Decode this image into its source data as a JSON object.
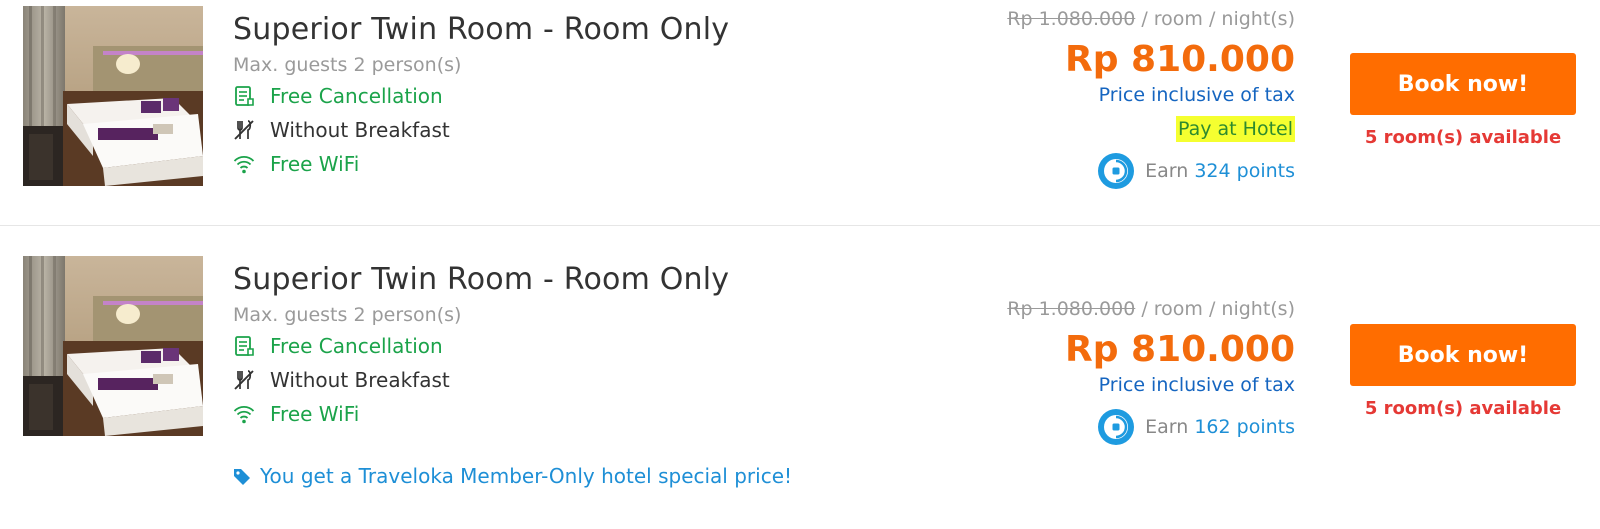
{
  "rooms": [
    {
      "name": "Superior Twin Room - Room Only",
      "max_guests": "Max. guests 2 person(s)",
      "features": {
        "cancellation": "Free Cancellation",
        "breakfast": "Without Breakfast",
        "wifi": "Free WiFi"
      },
      "old_price": "Rp 1.080.000",
      "price_unit": "/ room / night(s)",
      "price": "Rp 810.000",
      "tax_note": "Price inclusive of tax",
      "pay_at_hotel": "Pay at Hotel",
      "points_prefix": "Earn",
      "points_value": "324 points",
      "book_label": "Book now!",
      "availability": "5 room(s) available"
    },
    {
      "name": "Superior Twin Room - Room Only",
      "max_guests": "Max. guests 2 person(s)",
      "features": {
        "cancellation": "Free Cancellation",
        "breakfast": "Without Breakfast",
        "wifi": "Free WiFi"
      },
      "old_price": "Rp 1.080.000",
      "price_unit": "/ room / night(s)",
      "price": "Rp 810.000",
      "tax_note": "Price inclusive of tax",
      "points_prefix": "Earn",
      "points_value": "162 points",
      "book_label": "Book now!",
      "availability": "5 room(s) available",
      "member_note": "You get a Traveloka Member-Only hotel special price!"
    }
  ],
  "icons": {
    "cancellation": "receipt-icon",
    "breakfast": "no-breakfast-icon",
    "wifi": "wifi-icon",
    "points": "points-icon",
    "member": "tag-icon"
  },
  "colors": {
    "price": "#f36b0c",
    "book_button": "#ff6d00",
    "feature_green": "#1ba34a",
    "tax_blue": "#1565c0",
    "link_blue": "#1e8fd6",
    "availability_red": "#e53935",
    "highlight": "#f5ff30"
  }
}
